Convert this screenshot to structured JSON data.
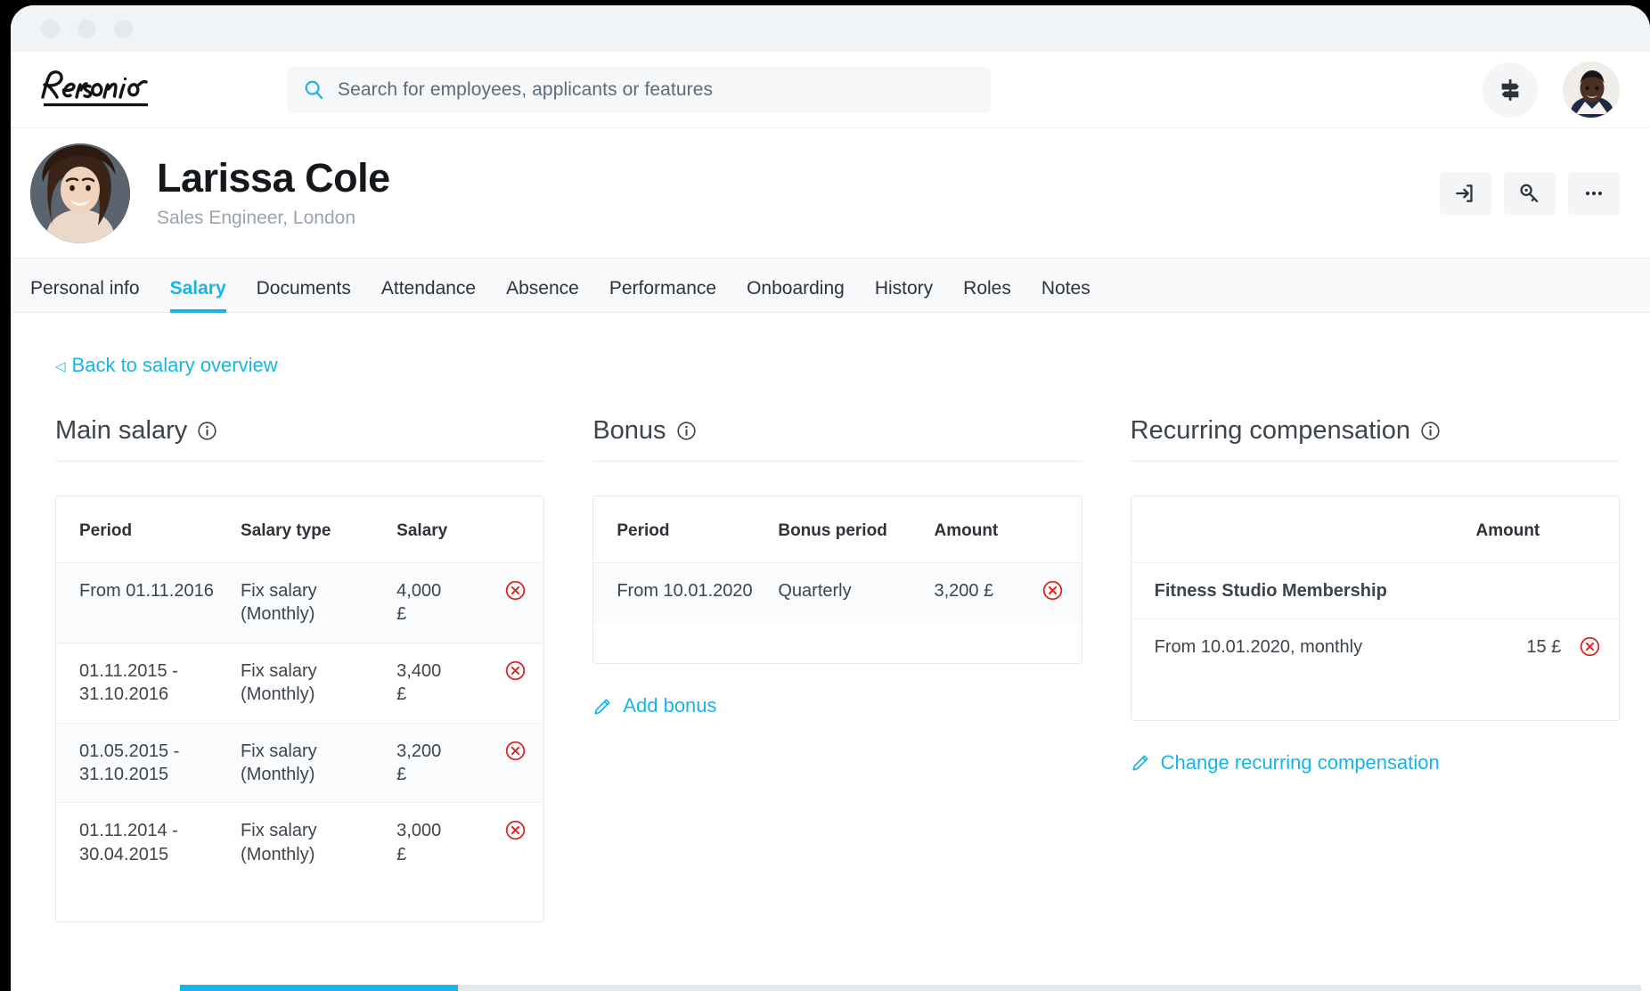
{
  "window": {
    "dots": [
      "close",
      "minimize",
      "maximize"
    ]
  },
  "topbar": {
    "logo_text": "Personio",
    "search": {
      "placeholder": "Search for employees, applicants or features",
      "value": "",
      "icon": "search-icon"
    },
    "signpost_icon": "signpost-icon",
    "avatar_alt": "account-avatar"
  },
  "profile": {
    "avatar_alt": "employee-avatar",
    "name": "Larissa Cole",
    "subtitle": "Sales Engineer, London",
    "actions": [
      {
        "name": "login-as-employee-button",
        "icon": "arrow-into-door-icon"
      },
      {
        "name": "reset-password-button",
        "icon": "key-icon"
      },
      {
        "name": "more-options-button",
        "icon": "ellipsis-icon"
      }
    ]
  },
  "tabs": [
    {
      "label": "Personal info",
      "active": false
    },
    {
      "label": "Salary",
      "active": true
    },
    {
      "label": "Documents",
      "active": false
    },
    {
      "label": "Attendance",
      "active": false
    },
    {
      "label": "Absence",
      "active": false
    },
    {
      "label": "Performance",
      "active": false
    },
    {
      "label": "Onboarding",
      "active": false
    },
    {
      "label": "History",
      "active": false
    },
    {
      "label": "Roles",
      "active": false
    },
    {
      "label": "Notes",
      "active": false
    }
  ],
  "back_link": {
    "caret": "◁",
    "label": "Back to salary overview"
  },
  "main_salary": {
    "title": "Main salary",
    "info_icon": "info-icon",
    "columns": [
      "Period",
      "Salary type",
      "Salary"
    ],
    "rows": [
      {
        "period": "From 01.11.2016",
        "type": "Fix salary\n(Monthly)",
        "salary": "4,000\n£",
        "delete_icon": "delete-circle-icon"
      },
      {
        "period": "01.11.2015 -\n31.10.2016",
        "type": "Fix salary\n(Monthly)",
        "salary": "3,400\n£",
        "delete_icon": "delete-circle-icon"
      },
      {
        "period": "01.05.2015 -\n31.10.2015",
        "type": "Fix salary\n(Monthly)",
        "salary": "3,200\n£",
        "delete_icon": "delete-circle-icon"
      },
      {
        "period": "01.11.2014 -\n30.04.2015",
        "type": "Fix salary\n(Monthly)",
        "salary": "3,000\n£",
        "delete_icon": "delete-circle-icon"
      }
    ]
  },
  "bonus": {
    "title": "Bonus",
    "info_icon": "info-icon",
    "columns": [
      "Period",
      "Bonus period",
      "Amount"
    ],
    "rows": [
      {
        "period": "From 10.01.2020",
        "bonus_period": "Quarterly",
        "amount": "3,200 £",
        "delete_icon": "delete-circle-icon"
      }
    ],
    "add_link": {
      "label": "Add bonus",
      "icon": "pencil-icon"
    }
  },
  "recurring": {
    "title": "Recurring compensation",
    "info_icon": "info-icon",
    "columns": [
      "",
      "Amount"
    ],
    "group_label": "Fitness Studio Membership",
    "rows": [
      {
        "period": "From 10.01.2020, monthly",
        "amount": "15 £",
        "delete_icon": "delete-circle-icon"
      }
    ],
    "change_link": {
      "label": "Change recurring compensation",
      "icon": "pencil-icon"
    }
  },
  "colors": {
    "accent": "#18b4e9",
    "danger": "#e02020",
    "text": "#2d3339",
    "muted": "#9aa3ac",
    "surface": "#f5f7f9"
  }
}
